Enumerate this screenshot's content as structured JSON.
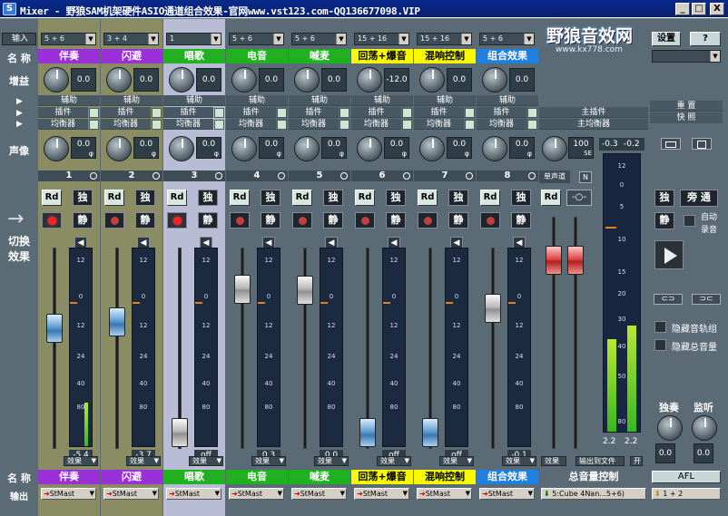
{
  "window": {
    "title": "Mixer - 野狼SAM机架硬件ASIO通道组合效果-官网www.vst123.com-QQ136677098.VIP",
    "icon": "S",
    "min": "_",
    "max": "□",
    "close": "X"
  },
  "logo": {
    "main": "野狼音效网",
    "sub": "www.kx778.com"
  },
  "row_labels": {
    "input": "输入",
    "name": "名 称",
    "gain": "增益",
    "pan": "声像",
    "switch": "切换",
    "effect": "效果",
    "name_bottom": "名 称",
    "output": "输出"
  },
  "channels": [
    {
      "input": "5 + 6",
      "name": "伴奏",
      "name_bg": "#9a30d8",
      "gain": "0.0",
      "pan": "0.0",
      "number": "1",
      "fader": -5.4,
      "meter_val": "-5.4",
      "fader_color": "blue",
      "rec_on": true,
      "mute_on": false,
      "strip_bg": "#8a8c64",
      "out": "StMast",
      "meter_level": 0.22
    },
    {
      "input": "3 + 4",
      "name": "闪避",
      "name_bg": "#9a30d8",
      "gain": "0.0",
      "pan": "0.0",
      "number": "2",
      "fader": -3.7,
      "meter_val": "-3.7",
      "fader_color": "blue",
      "rec_on": false,
      "mute_on": false,
      "strip_bg": "#8a8c64",
      "out": "StMast",
      "meter_level": 0
    },
    {
      "input": "1",
      "name": "唱歌",
      "name_bg": "#20b020",
      "gain": "0.0",
      "pan": "0.0",
      "number": "3",
      "fader": -100,
      "meter_val": "off",
      "fader_color": "gray",
      "rec_on": true,
      "mute_on": false,
      "strip_bg": "#b8bcd4",
      "out": "StMast",
      "meter_level": 0
    },
    {
      "input": "5 + 6",
      "name": "电音",
      "name_bg": "#20b020",
      "gain": "0.0",
      "pan": "0.0",
      "number": "4",
      "fader": 0.3,
      "meter_val": "0.3",
      "fader_color": "gray",
      "rec_on": false,
      "mute_on": false,
      "strip_bg": "#5b6b75",
      "out": "StMast",
      "meter_level": 0
    },
    {
      "input": "5 + 6",
      "name": "喊麦",
      "name_bg": "#20b020",
      "gain": "0.0",
      "pan": "0.0",
      "number": "5",
      "fader": 0.0,
      "meter_val": "0.0",
      "fader_color": "gray",
      "rec_on": false,
      "mute_on": false,
      "strip_bg": "#5b6b75",
      "out": "StMast",
      "meter_level": 0
    },
    {
      "input": "15 + 16",
      "name": "回荡+爆音",
      "name_bg": "#f8f800",
      "name_color": "#000",
      "gain": "-12.0",
      "pan": "0.0",
      "number": "6",
      "fader": -100,
      "meter_val": "off",
      "fader_color": "blue",
      "rec_on": false,
      "mute_on": false,
      "strip_bg": "#5b6b75",
      "out": "StMast",
      "meter_level": 0
    },
    {
      "input": "15 + 16",
      "name": "混响控制",
      "name_bg": "#f8f800",
      "name_color": "#000",
      "gain": "0.0",
      "pan": "0.0",
      "number": "7",
      "fader": -100,
      "meter_val": "off",
      "fader_color": "blue",
      "rec_on": false,
      "mute_on": false,
      "strip_bg": "#5b6b75",
      "out": "StMast",
      "meter_level": 0
    },
    {
      "input": "5 + 6",
      "name": "组合效果",
      "name_bg": "#2080e0",
      "gain": "0.0",
      "pan": "0.0",
      "number": "8",
      "fader": -0.1,
      "meter_val": "-0.1",
      "fader_color": "gray",
      "rec_on": false,
      "mute_on": false,
      "strip_bg": "#5b6b75",
      "out": "StMast",
      "meter_level": 0
    }
  ],
  "strip_rows": {
    "aux": "辅助",
    "insert": "插件",
    "eq": "均衡器",
    "solo": "独",
    "mute": "静",
    "rd": "Rd",
    "efx": "效果",
    "phase": "φ"
  },
  "scale": [
    "12",
    "0",
    "12",
    "24",
    "40",
    "80"
  ],
  "master": {
    "aux_master": "主插件",
    "eq_master": "主均衡器",
    "reset": "重 置",
    "snap": "快 照",
    "pan": "100",
    "pan_unit": "SE",
    "mono": "单声道",
    "n_btn": "N",
    "rd": "Rd",
    "peak_l": "-0.3",
    "peak_r": "-0.2",
    "scale": [
      "12",
      "0",
      "5",
      "10",
      "15",
      "20",
      "30",
      "40",
      "50",
      "80"
    ],
    "val_l": "2.2",
    "val_r": "2.2",
    "efx": "效果",
    "export": "输出到文件",
    "on": "开",
    "name": "总音量控制",
    "out": "5:Cube 4Nan...5+6)",
    "level_l": 0.33,
    "level_r": 0.38
  },
  "right_panel": {
    "settings": "设置",
    "help": "?",
    "solo": "独",
    "bypass": "旁 通",
    "mute": "静",
    "auto": "自动",
    "record": "录音",
    "hide_tracks": "隐藏音轨组",
    "hide_master": "隐藏总音量",
    "solo_knob": "独奏",
    "monitor_knob": "监听",
    "solo_val": "0.0",
    "monitor_val": "0.0",
    "afl": "AFL",
    "out": "1 + 2"
  }
}
